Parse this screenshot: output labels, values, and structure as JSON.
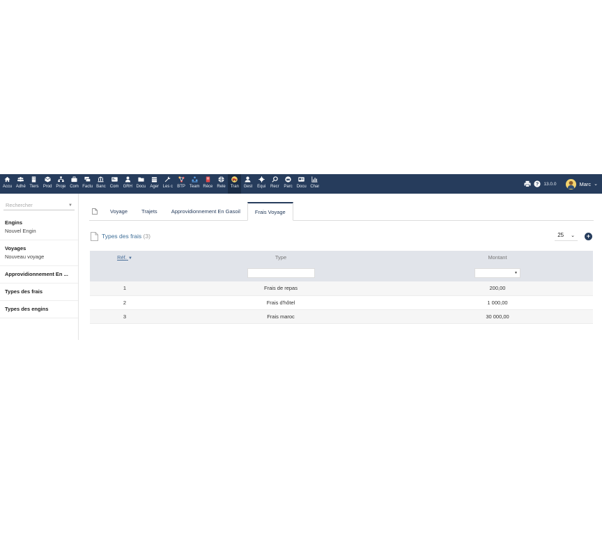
{
  "topbar": {
    "menu": [
      {
        "label": "Accu",
        "icon": "home-icon"
      },
      {
        "label": "Adhé",
        "icon": "users-icon"
      },
      {
        "label": "Tiers",
        "icon": "building-icon"
      },
      {
        "label": "Prod",
        "icon": "cube-icon"
      },
      {
        "label": "Proje",
        "icon": "sitemap-icon"
      },
      {
        "label": "Com",
        "icon": "briefcase-icon"
      },
      {
        "label": "Factu",
        "icon": "money-icon"
      },
      {
        "label": "Banc",
        "icon": "bank-icon"
      },
      {
        "label": "Com",
        "icon": "card-icon"
      },
      {
        "label": "GRH",
        "icon": "user-icon"
      },
      {
        "label": "Docu",
        "icon": "folder-icon"
      },
      {
        "label": "Ager",
        "icon": "calendar-icon"
      },
      {
        "label": "Les c",
        "icon": "wrench-icon"
      },
      {
        "label": "BTP",
        "icon": "network-icon"
      },
      {
        "label": "Team",
        "icon": "team-icon"
      },
      {
        "label": "Réce",
        "icon": "receipt-icon"
      },
      {
        "label": "Rele",
        "icon": "globe-icon"
      },
      {
        "label": "Tran",
        "icon": "truck-icon",
        "active": true
      },
      {
        "label": "Gest",
        "icon": "person-icon"
      },
      {
        "label": "Équi",
        "icon": "gear-icon"
      },
      {
        "label": "Recr",
        "icon": "search-icon"
      },
      {
        "label": "Parc",
        "icon": "car-icon"
      },
      {
        "label": "Docu",
        "icon": "card-icon"
      },
      {
        "label": "Char",
        "icon": "chart-icon"
      }
    ],
    "version": "13.0.0",
    "user_name": "Marc"
  },
  "sidebar": {
    "search_placeholder": "Rechercher",
    "blocks": [
      {
        "title": "Engins",
        "sub": "Nouvel Engin"
      },
      {
        "title": "Voyages",
        "sub": "Nouveau voyage"
      },
      {
        "title": "Approvidionnement En ..."
      },
      {
        "title": "Types des frais"
      },
      {
        "title": "Types des engins"
      }
    ]
  },
  "tabs": [
    "Voyage",
    "Trajets",
    "Approvidionnement En Gasoil",
    "Frais Voyage"
  ],
  "list": {
    "title": "Types des frais",
    "count": "(3)",
    "page_size": "25"
  },
  "table": {
    "headers": {
      "ref": "Réf.",
      "type": "Type",
      "montant": "Montant"
    },
    "rows": [
      {
        "ref": "1",
        "type": "Frais de repas",
        "montant": "200,00"
      },
      {
        "ref": "2",
        "type": "Frais d'hôtel",
        "montant": "1 000,00"
      },
      {
        "ref": "3",
        "type": "Frais maroc",
        "montant": "30 000,00"
      }
    ]
  }
}
